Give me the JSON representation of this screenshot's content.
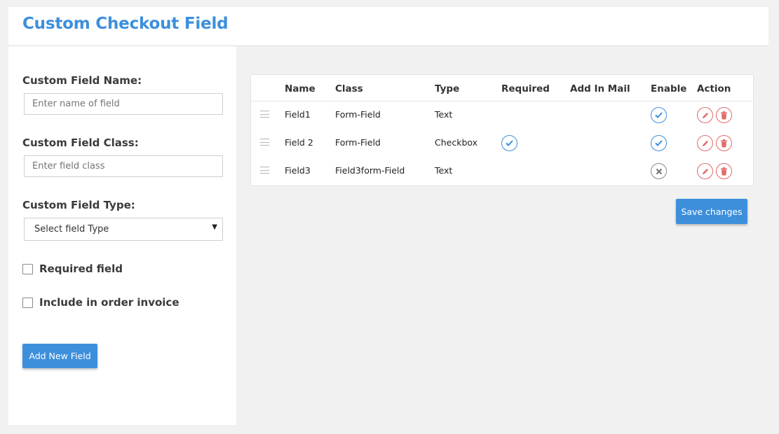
{
  "header": {
    "title": "Custom Checkout Field"
  },
  "form": {
    "name_label": "Custom Field Name:",
    "name_placeholder": "Enter name of field",
    "class_label": "Custom Field Class:",
    "class_placeholder": "Enter field class",
    "type_label": "Custom Field Type:",
    "type_selected": "Select field Type",
    "required_label": "Required field",
    "invoice_label": "Include in order invoice",
    "add_button": "Add New Field"
  },
  "table": {
    "columns": [
      "Name",
      "Class",
      "Type",
      "Required",
      "Add In Mail",
      "Enable",
      "Action"
    ],
    "rows": [
      {
        "name": "Field1",
        "class": "Form-Field",
        "type": "Text",
        "required": false,
        "add_in_mail": false,
        "enable": true
      },
      {
        "name": "Field 2",
        "class": "Form-Field",
        "type": "Checkbox",
        "required": true,
        "add_in_mail": false,
        "enable": true
      },
      {
        "name": "Field3",
        "class": "Field3form-Field",
        "type": "Text",
        "required": false,
        "add_in_mail": false,
        "enable": false
      }
    ]
  },
  "save_button": "Save changes",
  "colors": {
    "accent": "#3d8fdc",
    "danger": "#e06b6b",
    "disabled": "#888888"
  }
}
